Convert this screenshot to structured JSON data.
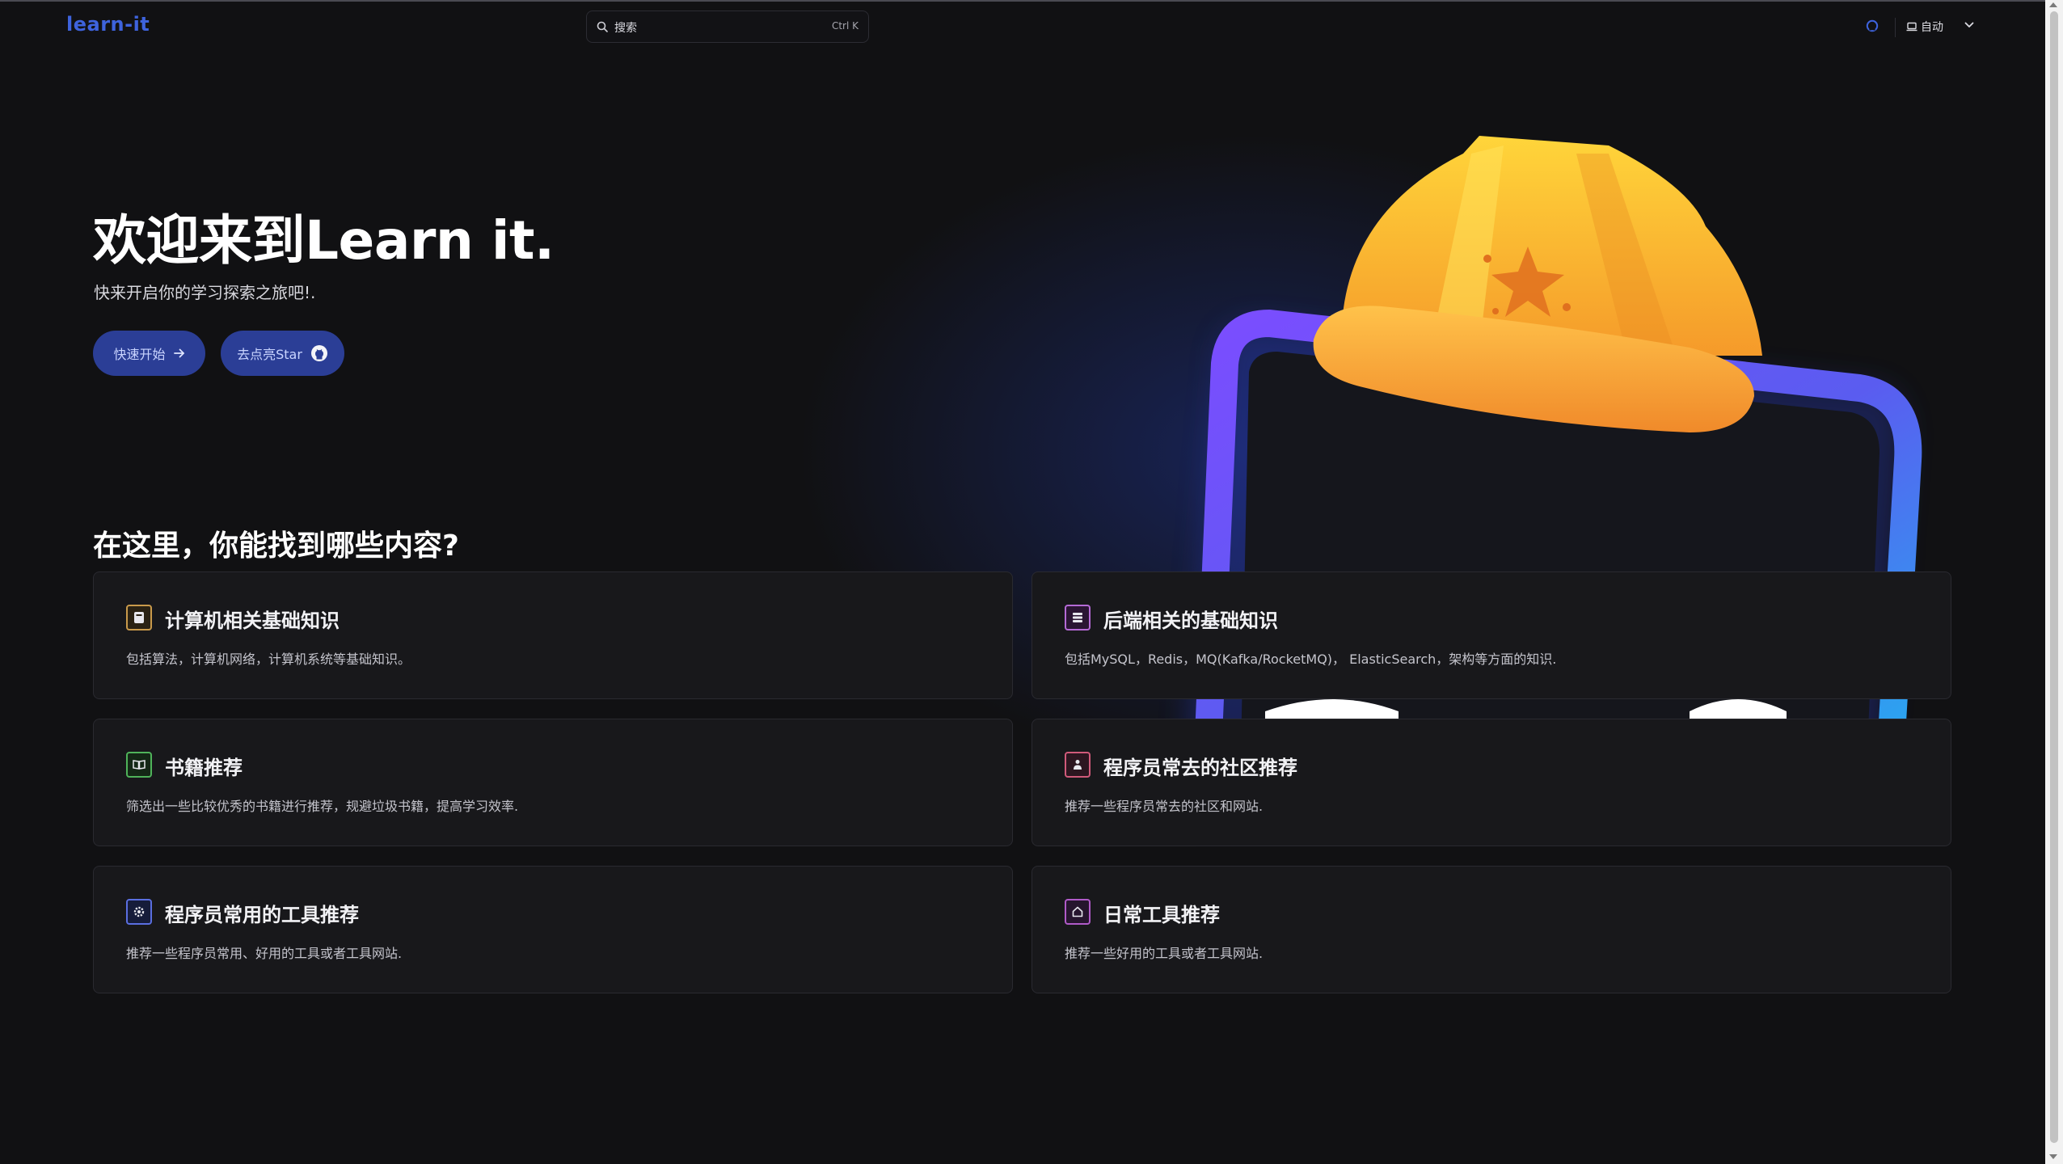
{
  "nav": {
    "logo": "learn-it",
    "search_placeholder": "搜索",
    "search_shortcut": "Ctrl K",
    "theme_label": "自动"
  },
  "hero": {
    "title": "欢迎来到Learn it.",
    "subtitle": "快来开启你的学习探索之旅吧!.",
    "start_button": "快速开始",
    "star_button": "去点亮Star"
  },
  "features": {
    "title": "在这里，你能找到哪些内容?",
    "items": [
      {
        "title": "计算机相关基础知识",
        "desc": "包括算法，计算机网络，计算机系统等基础知识。",
        "icon": "book-icon",
        "color": "#c99a4b"
      },
      {
        "title": "后端相关的基础知识",
        "desc": "包括MySQL，Redis，MQ(Kafka/RocketMQ)， ElasticSearch，架构等方面的知识.",
        "icon": "database-icon",
        "color": "#b56ad6"
      },
      {
        "title": "书籍推荐",
        "desc": "筛选出一些比较优秀的书籍进行推荐，规避垃圾书籍，提高学习效率.",
        "icon": "open-book-icon",
        "color": "#4fb35a"
      },
      {
        "title": "程序员常去的社区推荐",
        "desc": "推荐一些程序员常去的社区和网站.",
        "icon": "community-icon",
        "color": "#d05a7a"
      },
      {
        "title": "程序员常用的工具推荐",
        "desc": "推荐一些程序员常用、好用的工具或者工具网站.",
        "icon": "gear-icon",
        "color": "#5a6ee0"
      },
      {
        "title": "日常工具推荐",
        "desc": "推荐一些好用的工具或者工具网站.",
        "icon": "home-icon",
        "color": "#b05ac8"
      }
    ]
  },
  "colors": {
    "accent": "#3e63dd",
    "button_bg": "#2b3e96",
    "background": "#111113",
    "card_bg": "#18181b"
  }
}
